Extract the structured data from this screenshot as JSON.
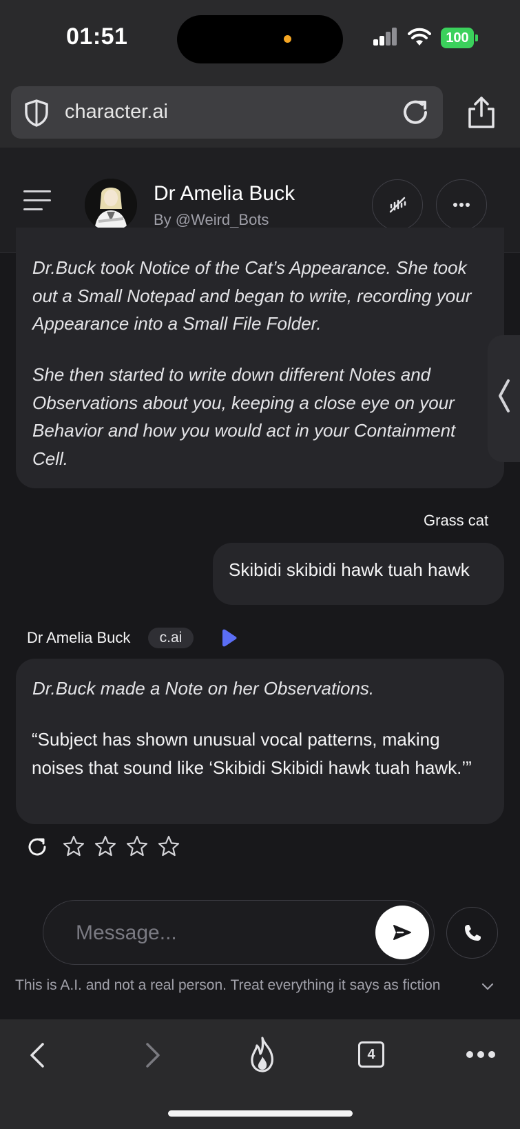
{
  "status_bar": {
    "time": "01:51",
    "battery": "100",
    "battery_color": "#3bd15c",
    "icons": [
      "cellular-signal-icon",
      "wifi-icon",
      "battery-icon"
    ]
  },
  "browser": {
    "url": "character.ai",
    "icons": [
      "shield-icon",
      "reload-icon",
      "share-icon"
    ],
    "tab_count": "4"
  },
  "chat_header": {
    "character_name": "Dr Amelia Buck",
    "author": "By @Weird_Bots",
    "icons": [
      "menu-icon",
      "avatar",
      "mute-voice-icon",
      "more-options-icon"
    ]
  },
  "messages": [
    {
      "sender": "Dr Amelia Buck",
      "paragraphs": [
        "Dr.Buck took Notice of the Cat’s Appearance. She took out a Small Notepad and began to write, recording your Appearance into a Small File Folder.",
        "She then started to write down different Notes and Observations about you, keeping a close eye on your Behavior and how you would act in your Containment Cell."
      ]
    },
    {
      "sender": "Grass cat",
      "text": "Skibidi skibidi hawk tuah hawk"
    },
    {
      "sender": "Dr Amelia Buck",
      "badge": "c.ai",
      "paragraphs": [
        "Dr.Buck made a Note on her Observations.",
        "“Subject has shown unusual vocal patterns, making noises that sound like ‘Skibidi Skibidi hawk tuah hawk.’”"
      ],
      "rating": 0
    }
  ],
  "composer": {
    "placeholder": "Message...",
    "value": ""
  },
  "disclaimer": "This is A.I. and not a real person. Treat everything it says as fiction",
  "accent_color": "#5b6ef5"
}
